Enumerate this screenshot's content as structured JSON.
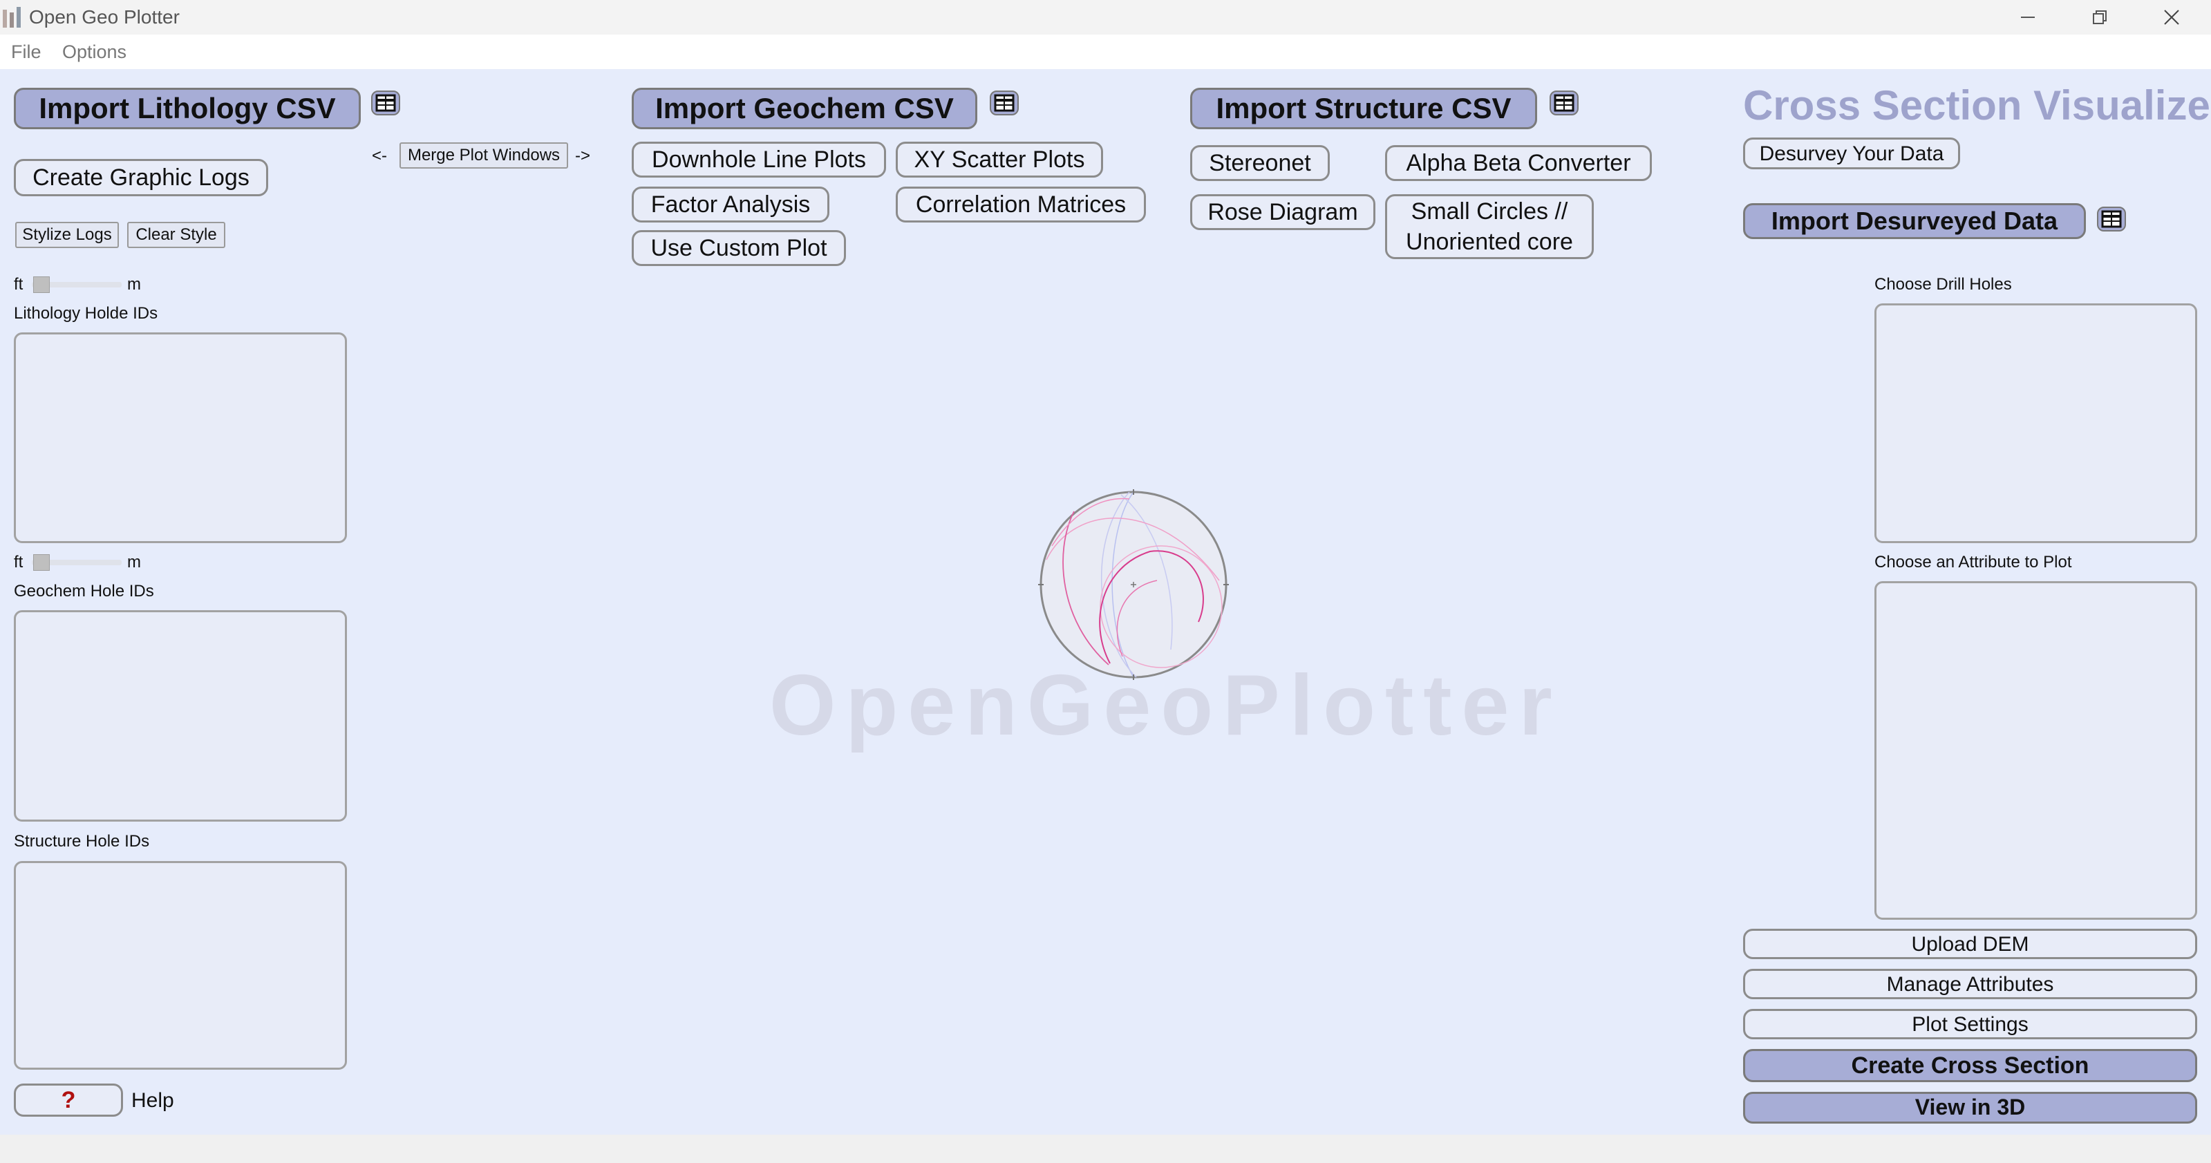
{
  "window": {
    "title": "Open Geo Plotter",
    "minimize_icon": "minimize-icon",
    "maximize_icon": "restore-icon",
    "close_icon": "close-icon"
  },
  "menu": [
    "File",
    "Options"
  ],
  "lithology": {
    "import_label": "Import Lithology CSV",
    "create_logs": "Create Graphic Logs",
    "stylize": "Stylize Logs",
    "clear_style": "Clear Style",
    "unit_ft": "ft",
    "unit_m": "m",
    "ids_label": "Lithology Holde IDs"
  },
  "merge": {
    "left_arrow": "<-",
    "label": "Merge Plot Windows",
    "right_arrow": "->"
  },
  "geochem": {
    "import_label": "Import Geochem CSV",
    "downhole": "Downhole Line Plots",
    "xy_scatter": "XY Scatter Plots",
    "factor": "Factor Analysis",
    "correlation": "Correlation Matrices",
    "custom": "Use Custom Plot",
    "unit_ft": "ft",
    "unit_m": "m",
    "ids_label": "Geochem Hole IDs"
  },
  "structure": {
    "import_label": "Import Structure CSV",
    "stereonet": "Stereonet",
    "alpha_beta": "Alpha Beta Converter",
    "rose": "Rose Diagram",
    "small_circles_1": "Small Circles //",
    "small_circles_2": "Unoriented core",
    "ids_label": "Structure Hole IDs"
  },
  "help": {
    "icon_label": "?",
    "label": "Help"
  },
  "watermark": "OpenGeoPlotter",
  "cross_section": {
    "title": "Cross Section Visualizer",
    "desurvey": "Desurvey Your Data",
    "import_desurveyed": "Import Desurveyed Data",
    "choose_holes": "Choose Drill Holes",
    "choose_attribute": "Choose an Attribute to Plot",
    "upload_dem": "Upload DEM",
    "manage_attributes": "Manage Attributes",
    "plot_settings": "Plot Settings",
    "create": "Create Cross Section",
    "view3d": "View in 3D"
  },
  "colors": {
    "background": "#e6ecfb",
    "button_accent": "#a7add6",
    "title_accent": "#9ea3cc",
    "help_red": "#b01010"
  }
}
